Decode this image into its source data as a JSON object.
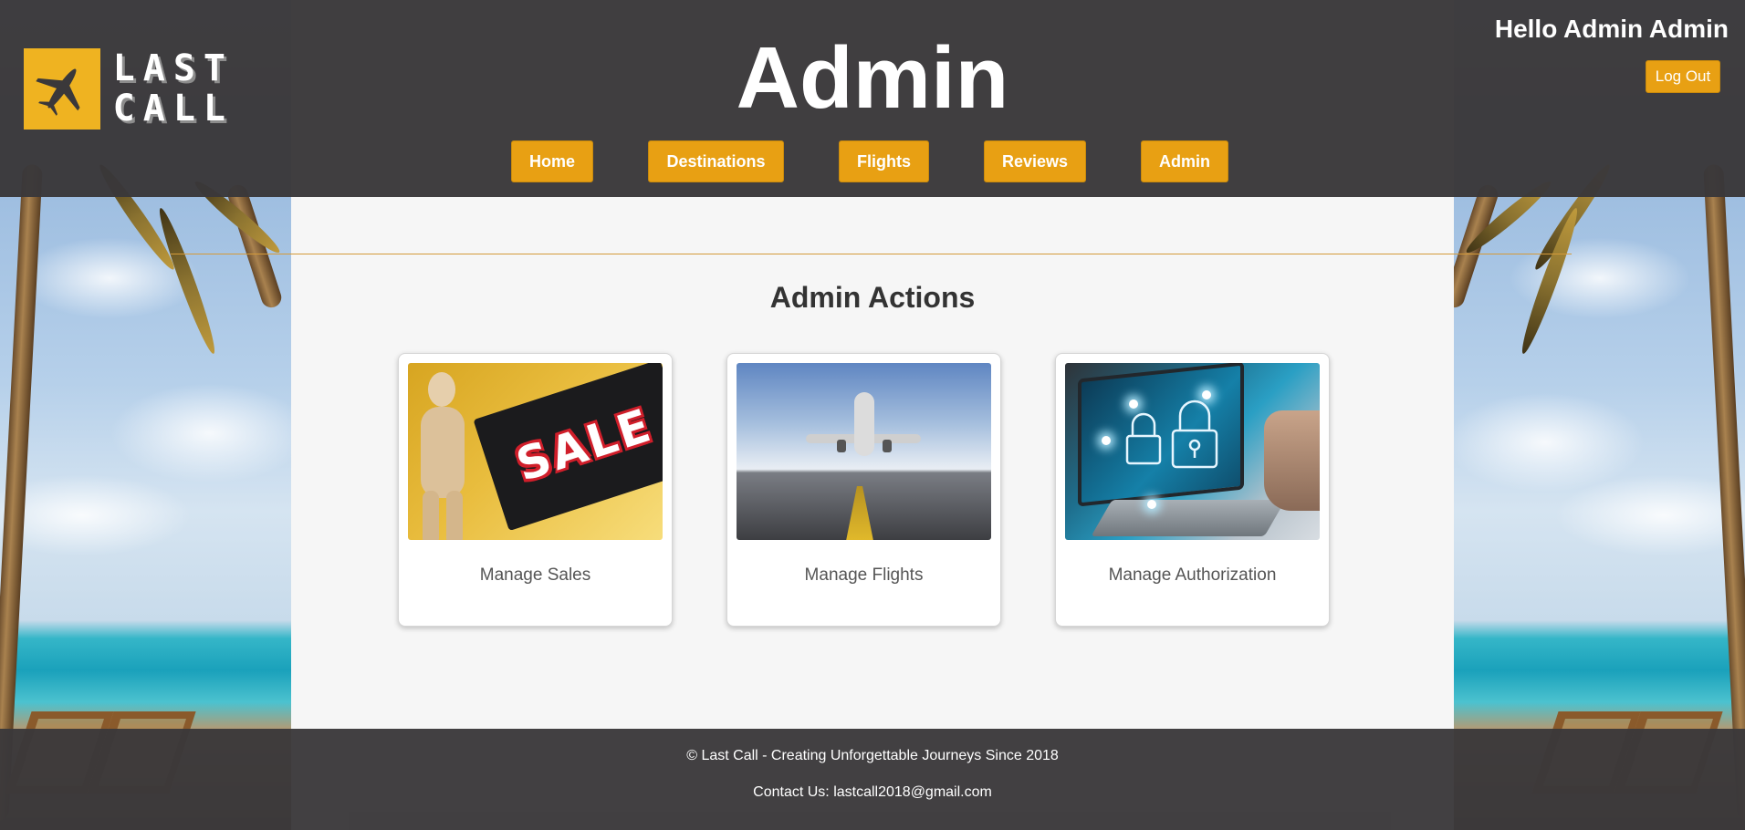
{
  "header": {
    "title": "Admin",
    "greeting": "Hello Admin Admin",
    "logout_label": "Log Out",
    "logo": {
      "line1": "LAST",
      "line2": "CALL"
    }
  },
  "nav": {
    "items": [
      {
        "label": "Home"
      },
      {
        "label": "Destinations"
      },
      {
        "label": "Flights"
      },
      {
        "label": "Reviews"
      },
      {
        "label": "Admin"
      }
    ]
  },
  "main": {
    "section_title": "Admin Actions",
    "cards": [
      {
        "label": "Manage Sales",
        "image_text": "SALE"
      },
      {
        "label": "Manage Flights"
      },
      {
        "label": "Manage Authorization"
      }
    ]
  },
  "footer": {
    "copyright": "© Last Call - Creating Unforgettable Journeys Since 2018",
    "contact": "Contact Us: lastcall2018@gmail.com"
  },
  "colors": {
    "accent": "#e8a013",
    "header_bg": "#3a383a",
    "content_bg": "#f6f6f6",
    "logo_badge": "#efb321"
  },
  "icons": {
    "logo": "airplane-icon"
  }
}
